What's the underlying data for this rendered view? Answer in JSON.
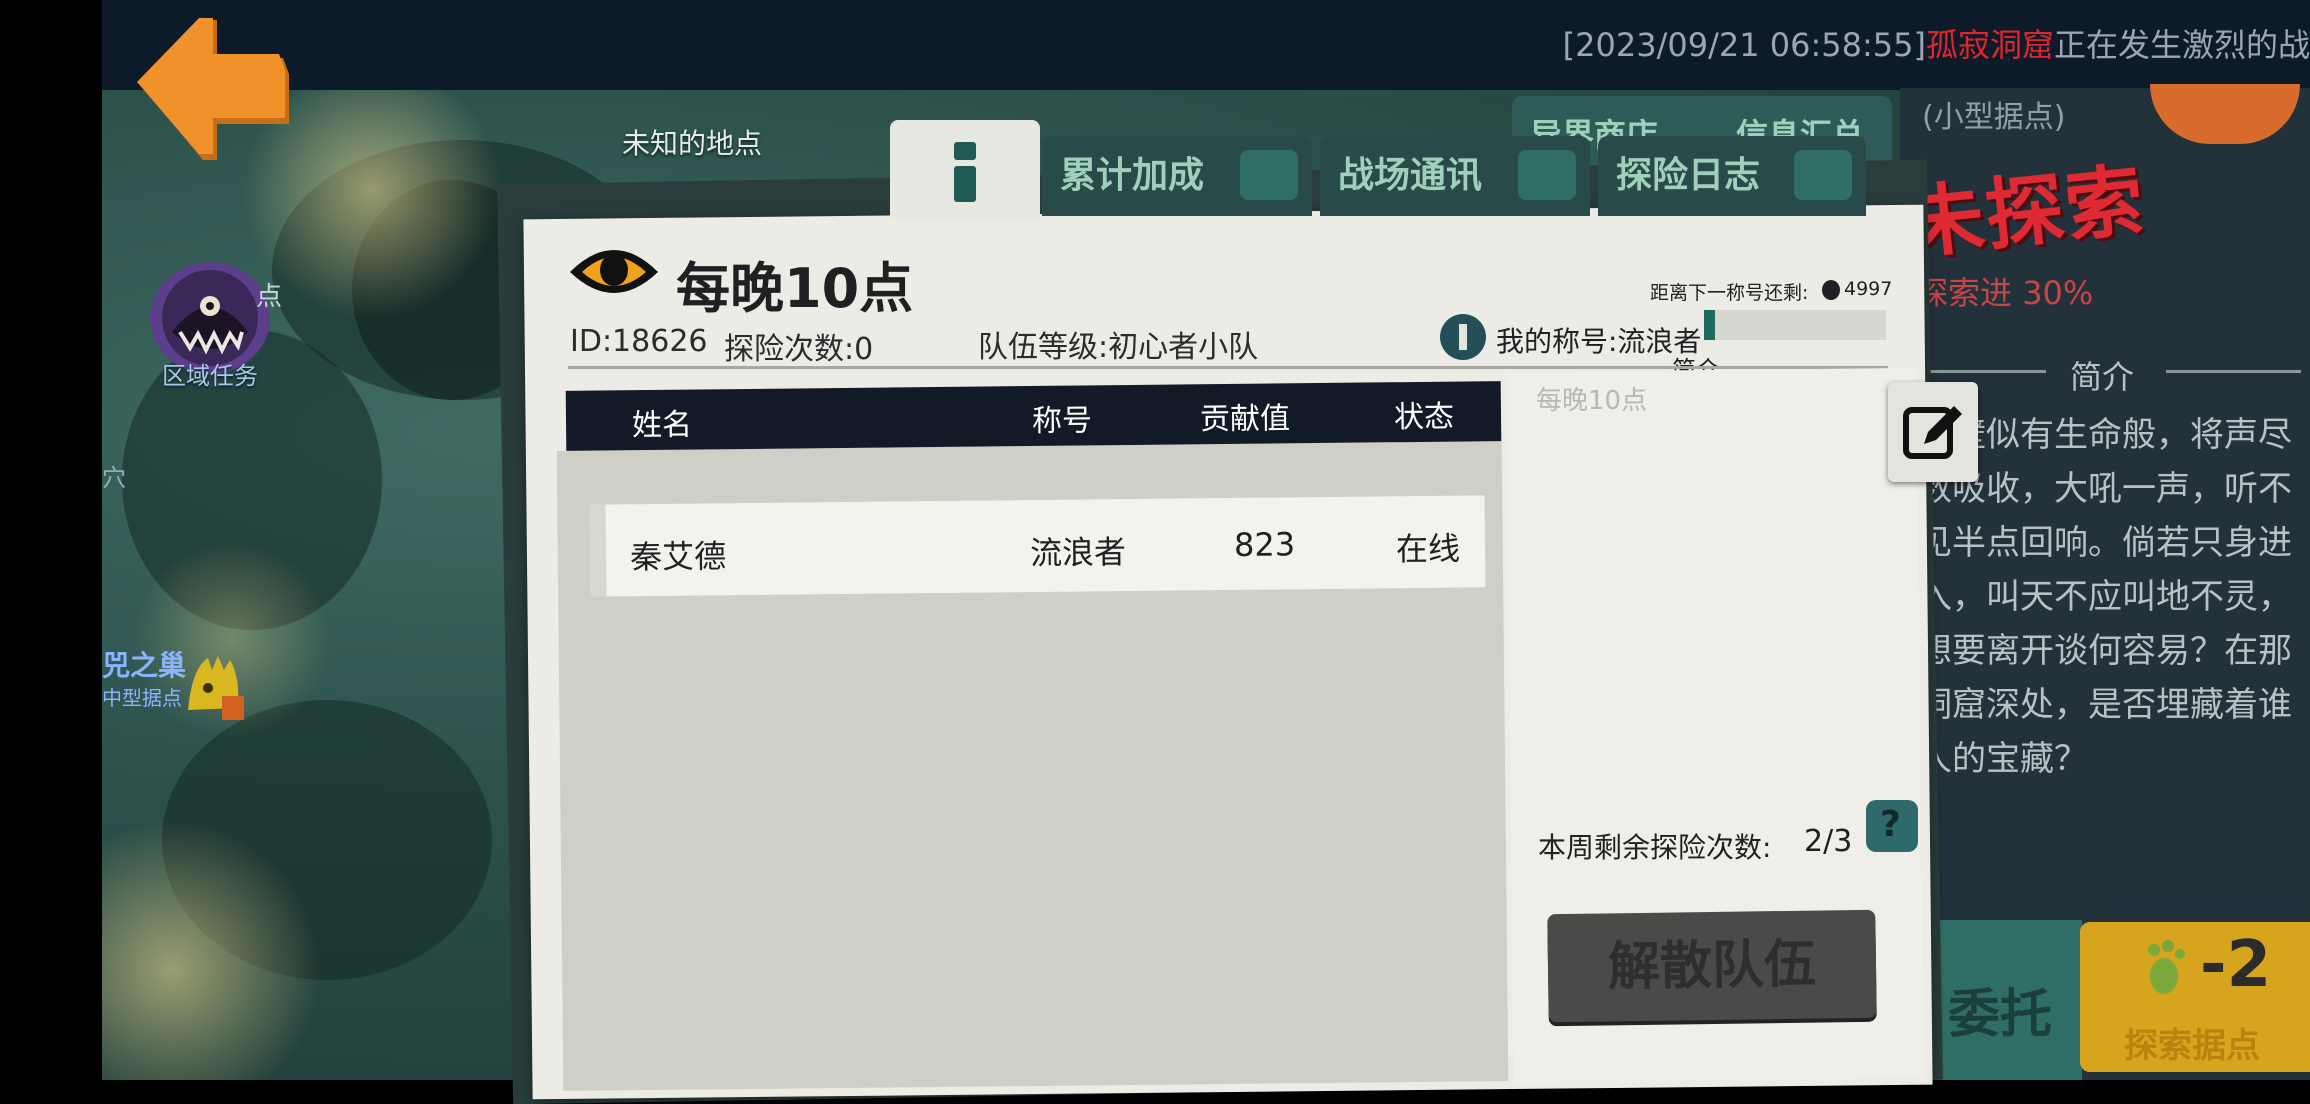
{
  "ticker": {
    "timestamp": "[2023/09/21 06:58:55]",
    "location": "孤寂洞窟",
    "message": "正在发生激烈的战"
  },
  "map": {
    "unknown_location": "未知的地点",
    "region_task": "区域任务",
    "region_task_partial": "点",
    "nest_label": "兕之巢",
    "nest_sub": "中型据点",
    "left_edge_char": "穴"
  },
  "right_panel": {
    "tab_shop": "异界商店",
    "tab_info": "信息汇总",
    "base_type": "(小型据点)",
    "status": "未探索",
    "progress_label": "探索进",
    "progress_value": "30%",
    "intro_title": "简介",
    "intro_text": "洞壁似有生命般，将声尽数吸收，大吼一声，听不见半点回响。倘若只身进入，叫天不应叫地不灵，想要离开谈何容易？在那洞窟深处，是否埋藏着谁人的宝藏？",
    "commission": "委托",
    "explore_cost": "-2",
    "explore_label": "探索据点"
  },
  "tabs": [
    {
      "label": "累计加成"
    },
    {
      "label": "战场通讯"
    },
    {
      "label": "探险日志"
    }
  ],
  "team": {
    "name": "每晚10点",
    "id_label": "ID:18626",
    "explore_count_label": "探险次数:0",
    "level_label": "队伍等级:初心者小队",
    "next_title_label": "距离下一称号还剩:",
    "next_title_value": "4997",
    "my_title_label": "我的称号:流浪者",
    "intro_heading": "简介",
    "intro_text": "每晚10点",
    "weekly_remaining_label": "本周剩余探险次数:",
    "weekly_remaining_value": "2/3",
    "disband_label": "解散队伍",
    "title_progress": 0.06
  },
  "table": {
    "headers": [
      "姓名",
      "称号",
      "贡献值",
      "状态"
    ],
    "rows": [
      {
        "name": "秦艾德",
        "title": "流浪者",
        "contribution": "823",
        "status": "在线"
      }
    ]
  },
  "colors": {
    "accent_red": "#e0262c",
    "tab_text": "#9fd0bc",
    "gold": "#d6a51d"
  }
}
